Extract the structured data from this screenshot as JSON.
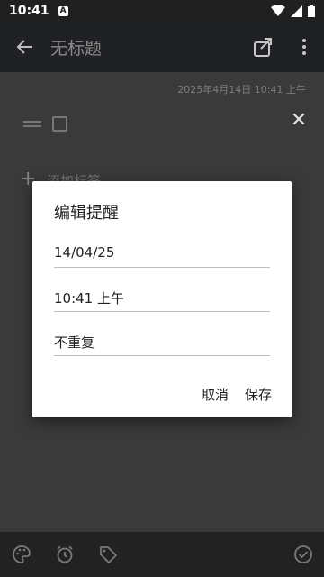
{
  "status_bar": {
    "time": "10:41",
    "notification_letter": "A"
  },
  "app_bar": {
    "title": "无标题"
  },
  "note": {
    "date": "2025年4月14日 10:41 上午",
    "add_tag_label": "添加标签"
  },
  "dialog": {
    "title": "编辑提醒",
    "date_value": "14/04/25",
    "time_value": "10:41 上午",
    "repeat_value": "不重复",
    "cancel_label": "取消",
    "save_label": "保存"
  },
  "icons": {
    "back": "back-arrow-icon",
    "share": "share-icon",
    "more": "more-vert-icon",
    "palette": "palette-icon",
    "alarm": "alarm-icon",
    "tag": "tag-icon",
    "done": "check-circle-icon"
  }
}
